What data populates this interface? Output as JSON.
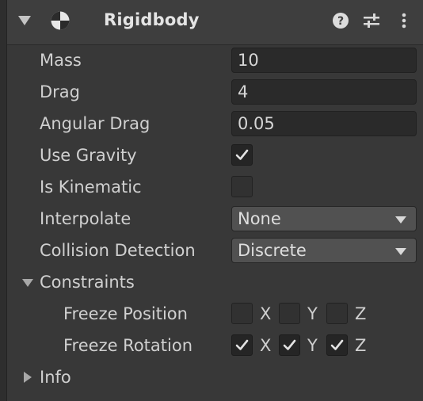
{
  "component": {
    "title": "Rigidbody",
    "icons": [
      "rigidbody-icon",
      "help-icon",
      "preset-icon",
      "more-options-icon"
    ]
  },
  "fields": {
    "mass": {
      "label": "Mass",
      "value": "10"
    },
    "drag": {
      "label": "Drag",
      "value": "4"
    },
    "angular_drag": {
      "label": "Angular Drag",
      "value": "0.05"
    },
    "use_gravity": {
      "label": "Use Gravity",
      "checked": true
    },
    "is_kinematic": {
      "label": "Is Kinematic",
      "checked": false
    },
    "interpolate": {
      "label": "Interpolate",
      "value": "None"
    },
    "collision_detection": {
      "label": "Collision Detection",
      "value": "Discrete"
    }
  },
  "constraints": {
    "label": "Constraints",
    "expanded": true,
    "freeze_position": {
      "label": "Freeze Position",
      "x": false,
      "y": false,
      "z": false
    },
    "freeze_rotation": {
      "label": "Freeze Rotation",
      "x": true,
      "y": true,
      "z": true
    },
    "axes": {
      "x": "X",
      "y": "Y",
      "z": "Z"
    }
  },
  "info": {
    "label": "Info",
    "expanded": false
  },
  "colors": {
    "background": "#383838",
    "field": "#2a2a2a",
    "text": "#d2d2d2"
  }
}
